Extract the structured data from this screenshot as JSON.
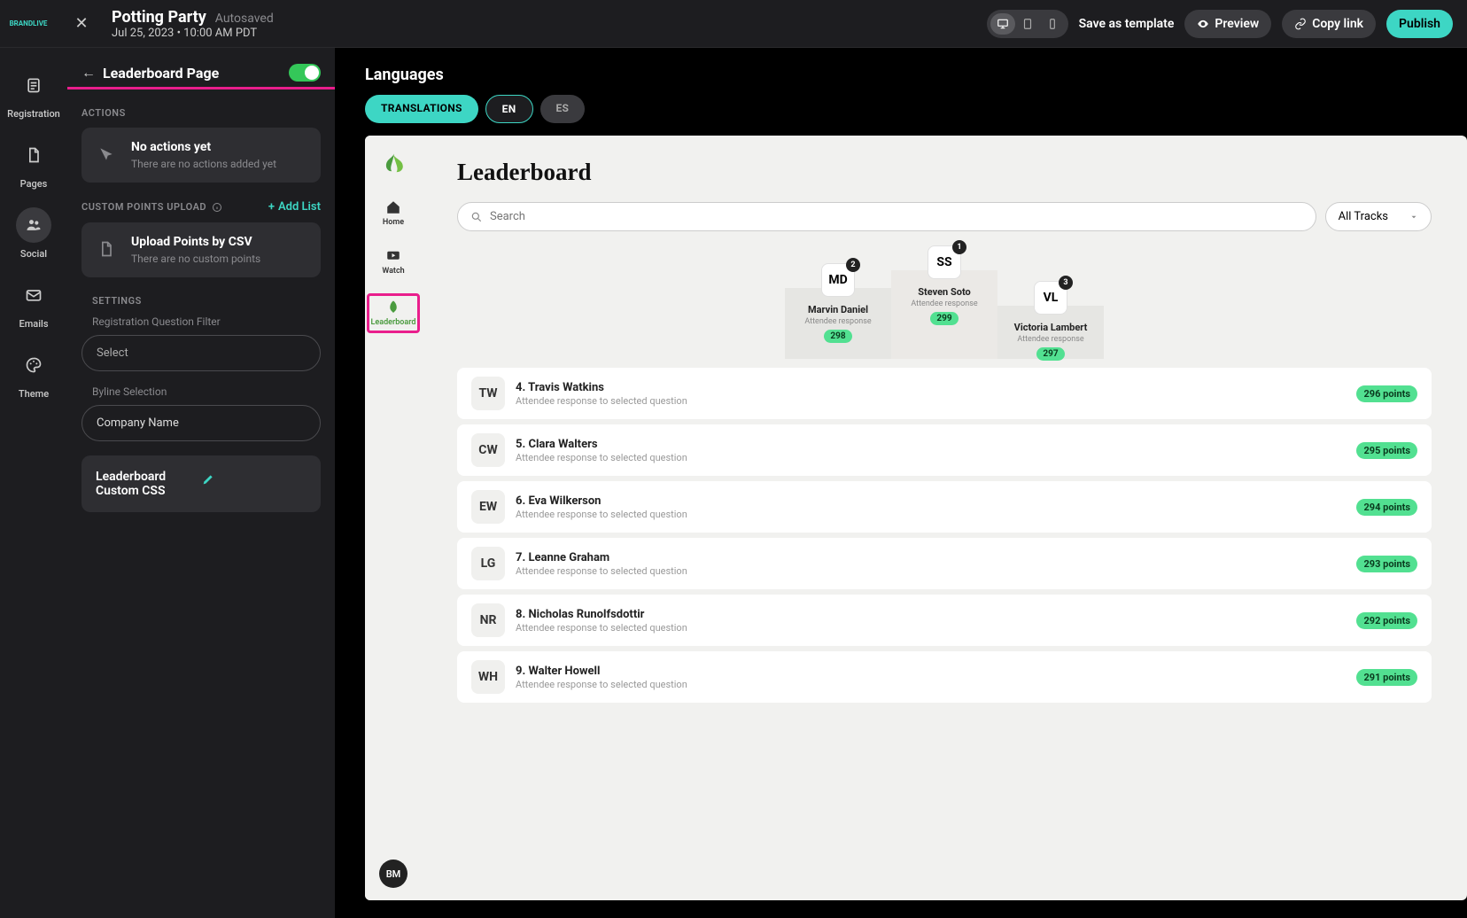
{
  "header": {
    "brand": "BRANDLIVE",
    "title": "Potting Party",
    "status": "Autosaved",
    "datetime": "Jul 25, 2023 • 10:00 AM PDT",
    "save_template": "Save as template",
    "preview": "Preview",
    "copy_link": "Copy link",
    "publish": "Publish"
  },
  "rail": {
    "registration": "Registration",
    "pages": "Pages",
    "social": "Social",
    "emails": "Emails",
    "theme": "Theme"
  },
  "editor": {
    "title": "Leaderboard Page",
    "actions_label": "ACTIONS",
    "no_actions_h": "No actions yet",
    "no_actions_s": "There are no actions added yet",
    "custom_points_label": "CUSTOM POINTS UPLOAD",
    "add_list": "Add List",
    "upload_h": "Upload Points by CSV",
    "upload_s": "There are no custom points",
    "settings_label": "SETTINGS",
    "reg_q_filter": "Registration Question Filter",
    "select": "Select",
    "byline_label": "Byline Selection",
    "byline_value": "Company Name",
    "css_h": "Leaderboard Custom CSS"
  },
  "languages": {
    "title": "Languages",
    "translations": "TRANSLATIONS",
    "en": "EN",
    "es": "ES"
  },
  "frame": {
    "nav_home": "Home",
    "nav_watch": "Watch",
    "nav_leaderboard": "Leaderboard",
    "user_initials": "BM",
    "title": "Leaderboard",
    "search_placeholder": "Search",
    "filter": "All Tracks",
    "podium": [
      {
        "rank": "2",
        "initials": "MD",
        "name": "Marvin Daniel",
        "sub": "Attendee response",
        "pts": "298"
      },
      {
        "rank": "1",
        "initials": "SS",
        "name": "Steven Soto",
        "sub": "Attendee response",
        "pts": "299"
      },
      {
        "rank": "3",
        "initials": "VL",
        "name": "Victoria Lambert",
        "sub": "Attendee response",
        "pts": "297"
      }
    ],
    "rows": [
      {
        "initials": "TW",
        "name": "4. Travis Watkins",
        "sub": "Attendee response to selected question",
        "pts": "296 points"
      },
      {
        "initials": "CW",
        "name": "5. Clara Walters",
        "sub": "Attendee response to selected question",
        "pts": "295 points"
      },
      {
        "initials": "EW",
        "name": "6. Eva Wilkerson",
        "sub": "Attendee response to selected question",
        "pts": "294 points"
      },
      {
        "initials": "LG",
        "name": "7. Leanne Graham",
        "sub": "Attendee response to selected question",
        "pts": "293 points"
      },
      {
        "initials": "NR",
        "name": "8. Nicholas Runolfsdottir",
        "sub": "Attendee response to selected question",
        "pts": "292 points"
      },
      {
        "initials": "WH",
        "name": "9. Walter Howell",
        "sub": "Attendee response to selected question",
        "pts": "291 points"
      }
    ]
  }
}
